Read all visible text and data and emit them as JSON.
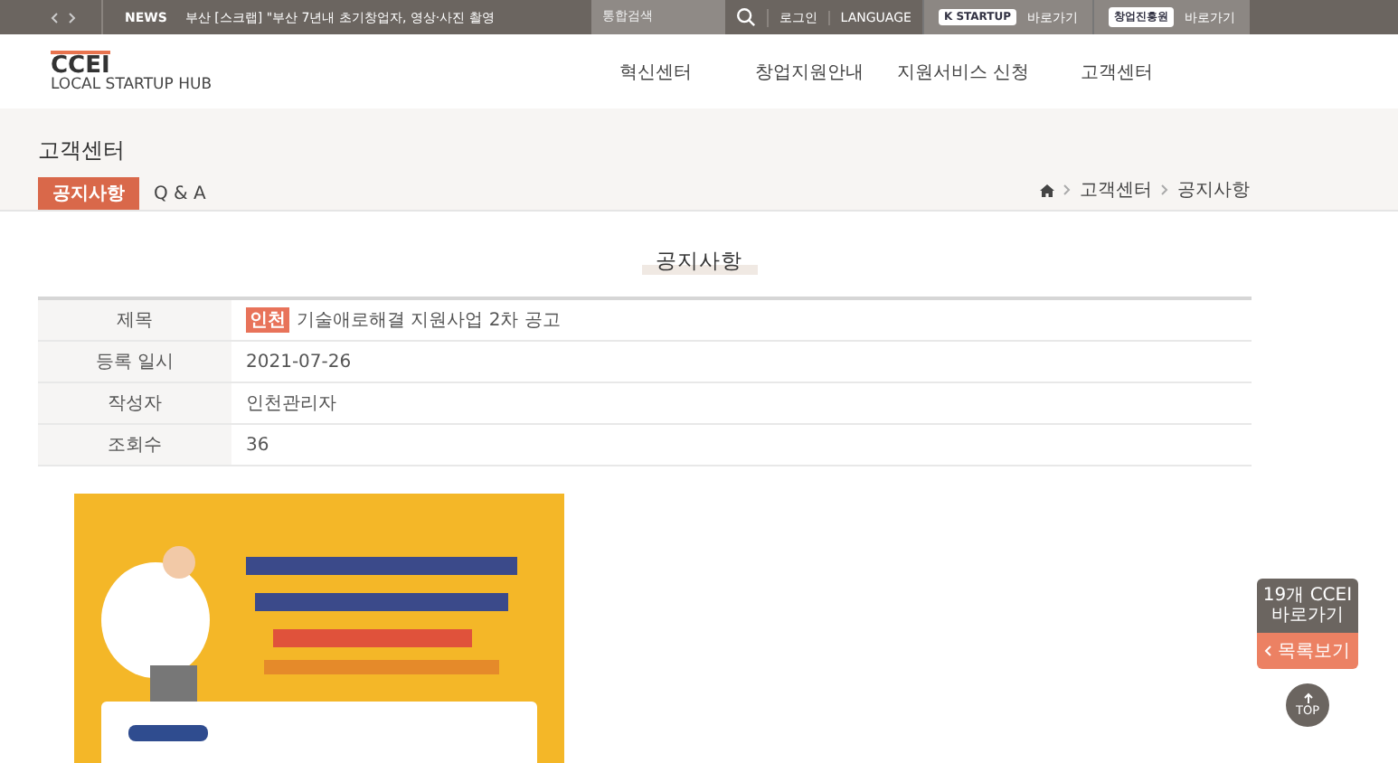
{
  "top_bar": {
    "news_label": "NEWS",
    "news_text": "부산 [스크랩] \"부산 7년내 초기창업자, 영상·사진 촬영",
    "search": {
      "placeholder": "통합검색"
    },
    "links": [
      "로그인",
      "LANGUAGE"
    ],
    "partners": [
      {
        "logo": "K STARTUP",
        "link": "바로가기"
      },
      {
        "logo": "창업진흥원",
        "link": "바로가기"
      }
    ]
  },
  "logo": {
    "title": "CCEI",
    "subtitle": "LOCAL STARTUP HUB"
  },
  "nav": [
    "혁신센터",
    "창업지원안내",
    "지원서비스 신청",
    "고객센터"
  ],
  "page_title": "고객센터",
  "tabs": [
    {
      "label": "공지사항",
      "selected": true
    },
    {
      "label": "Q & A",
      "selected": false
    }
  ],
  "breadcrumb": [
    "고객센터",
    "공지사항"
  ],
  "section_title": "공지사항",
  "details": [
    {
      "label": "제목",
      "tag": "인천",
      "value": "기술애로해결 지원사업 2차 공고"
    },
    {
      "label": "등록 일시",
      "value": "2021-07-26"
    },
    {
      "label": "작성자",
      "value": "인천관리자"
    },
    {
      "label": "조회수",
      "value": "36"
    }
  ],
  "side": {
    "centers": "19개 CCEI 바로가기",
    "list": "목록보기",
    "top": "TOP"
  }
}
